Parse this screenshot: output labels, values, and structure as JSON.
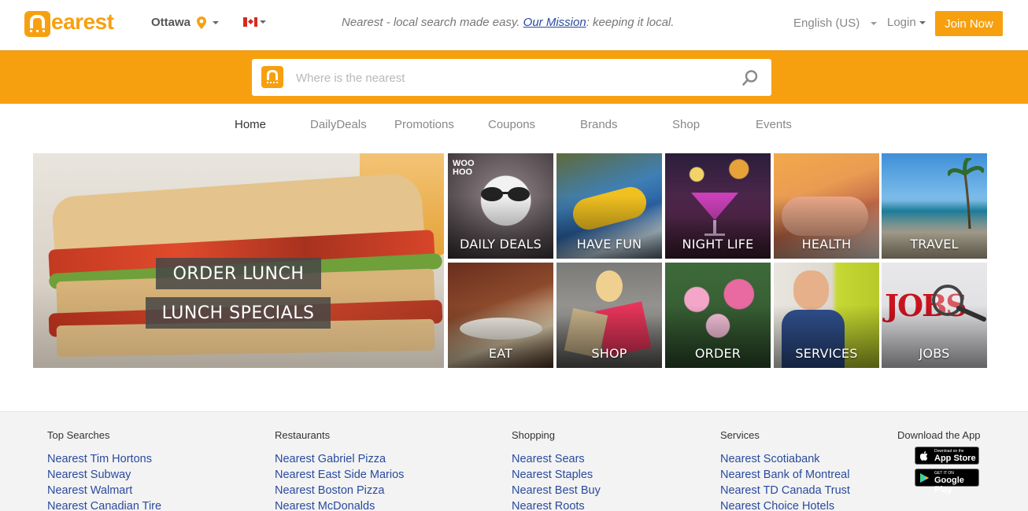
{
  "header": {
    "logo_text": "earest",
    "city": "Ottawa",
    "tagline_prefix": "Nearest - local search made easy.",
    "mission_link": "Our Mission",
    "tagline_suffix": ": keeping it local.",
    "language": "English (US)",
    "login": "Login",
    "join_button": "Join Now"
  },
  "search": {
    "placeholder": "Where is the nearest"
  },
  "nav": {
    "items": [
      "Home",
      "DailyDeals",
      "Promotions",
      "Coupons",
      "Brands",
      "Shop",
      "Events"
    ],
    "active": "Home"
  },
  "hero": {
    "line1": "ORDER LUNCH",
    "line2": "LUNCH SPECIALS"
  },
  "tiles": [
    {
      "label": "DAILY DEALS",
      "badge_line1": "WOO",
      "badge_line2": "HOO"
    },
    {
      "label": "HAVE FUN"
    },
    {
      "label": "NIGHT LIFE"
    },
    {
      "label": "HEALTH"
    },
    {
      "label": "TRAVEL"
    },
    {
      "label": "EAT"
    },
    {
      "label": "SHOP"
    },
    {
      "label": "ORDER"
    },
    {
      "label": "SERVICES"
    },
    {
      "label": "JOBS",
      "image_text": "JOBS"
    }
  ],
  "footer": {
    "top_searches": {
      "heading": "Top Searches",
      "links": [
        "Nearest Tim Hortons",
        "Nearest Subway",
        "Nearest Walmart",
        "Nearest Canadian Tire"
      ]
    },
    "restaurants": {
      "heading": "Restaurants",
      "links": [
        "Nearest Gabriel Pizza",
        "Nearest East Side Marios",
        "Nearest Boston Pizza",
        "Nearest McDonalds"
      ]
    },
    "shopping": {
      "heading": "Shopping",
      "links": [
        "Nearest Sears",
        "Nearest Staples",
        "Nearest Best Buy",
        "Nearest Roots"
      ]
    },
    "services": {
      "heading": "Services",
      "links": [
        "Nearest Scotiabank",
        "Nearest Bank of Montreal",
        "Nearest TD Canada Trust",
        "Nearest Choice Hotels"
      ]
    },
    "app": {
      "heading": "Download the App",
      "appstore_small": "Download on the",
      "appstore_big": "App Store",
      "googleplay_small": "GET IT ON",
      "googleplay_big": "Google Play"
    }
  },
  "colors": {
    "brand_orange": "#f7a00f",
    "link_blue": "#2a4a9e"
  }
}
